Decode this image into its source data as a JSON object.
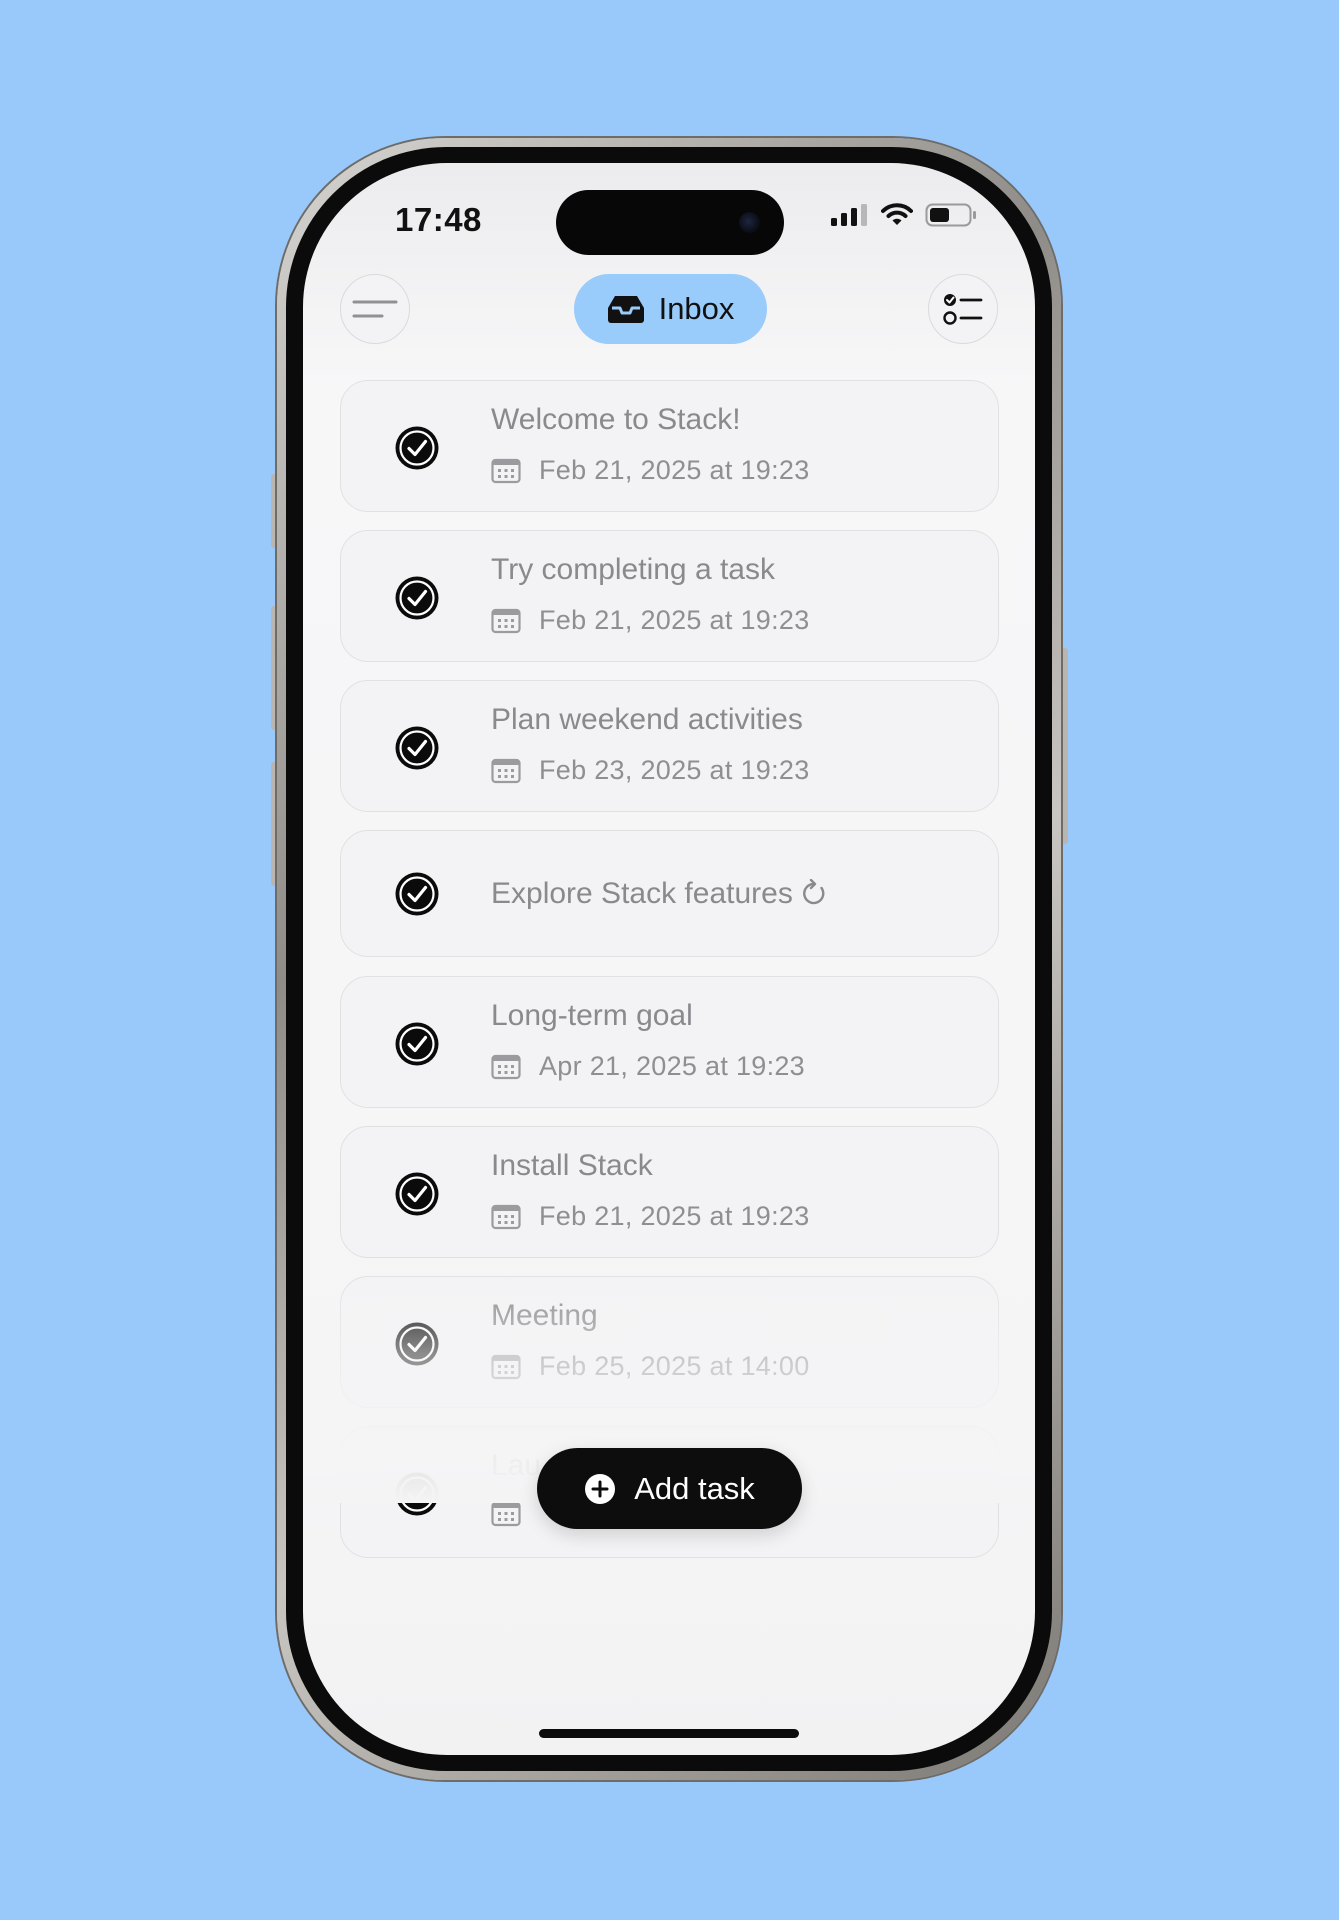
{
  "status_bar": {
    "time": "17:48",
    "icons": [
      "signal-icon",
      "wifi-icon",
      "battery-icon"
    ]
  },
  "header": {
    "menu_icon": "menu-icon",
    "title": "Inbox",
    "title_icon": "inbox-tray-icon",
    "filter_icon": "checklist-icon"
  },
  "tasks": [
    {
      "title": "Welcome to Stack!",
      "date": "Feb 21, 2025 at 19:23",
      "completed": true
    },
    {
      "title": "Try completing a task",
      "date": "Feb 21, 2025 at 19:23",
      "completed": true
    },
    {
      "title": "Plan weekend activities",
      "date": "Feb 23, 2025 at 19:23",
      "completed": true
    },
    {
      "title": "Explore Stack features",
      "date": "",
      "repeat": true,
      "completed": true
    },
    {
      "title": "Long-term goal",
      "date": "Apr 21, 2025 at 19:23",
      "completed": true
    },
    {
      "title": "Install Stack",
      "date": "Feb 21, 2025 at 19:23",
      "completed": true
    },
    {
      "title": "Meeting",
      "date": "Feb 25, 2025 at 14:00",
      "completed": true
    },
    {
      "title": "Lau",
      "date": "",
      "completed": true
    }
  ],
  "actions": {
    "add_task_label": "Add task",
    "add_task_icon": "plus-circle-icon"
  },
  "colors": {
    "background": "#99c9fa",
    "accent": "#99cbfb",
    "card": "#f3f3f5",
    "text_muted": "#8a8a8e"
  }
}
